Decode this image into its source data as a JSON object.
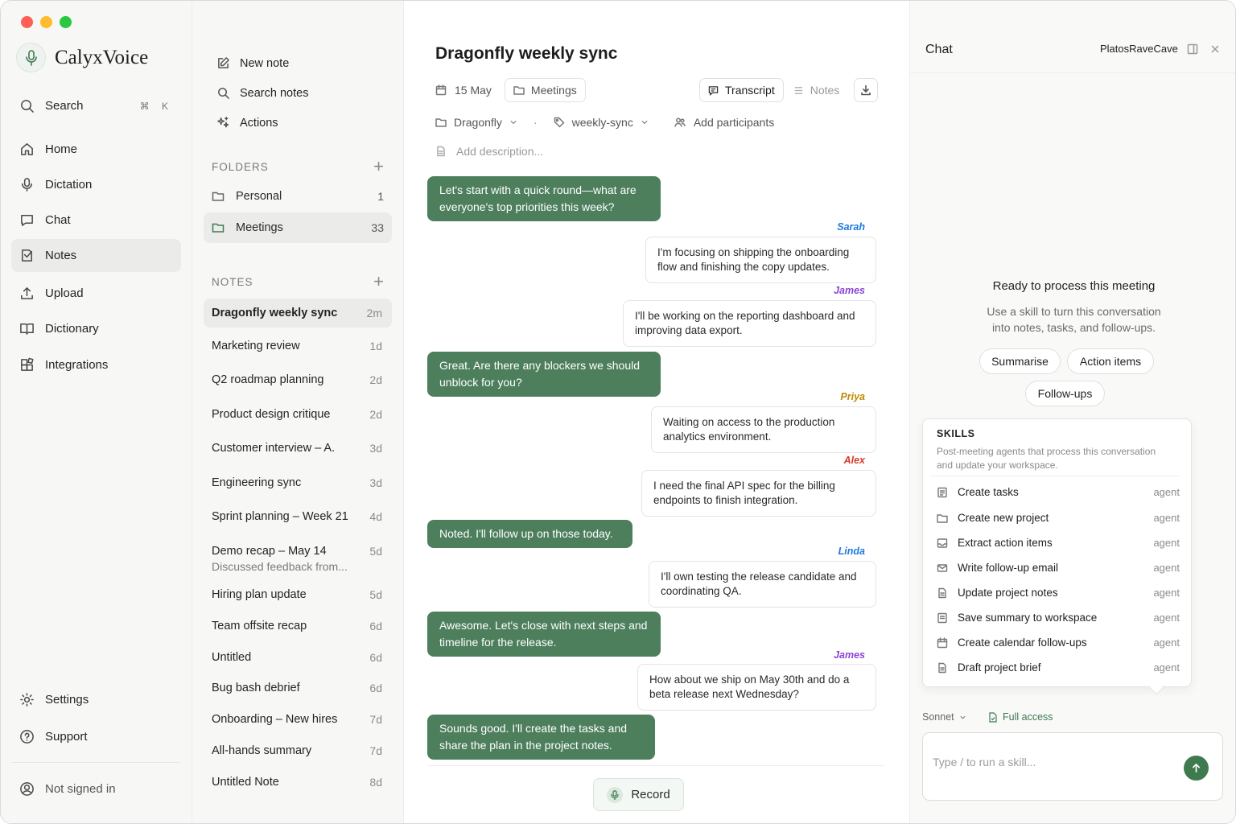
{
  "window": {
    "traffic_colors": [
      "#fe5f57",
      "#febc2e",
      "#28c840"
    ]
  },
  "brand": {
    "name": "CalyxVoice",
    "accent": "#3f7a4f"
  },
  "sidebar": {
    "search": {
      "label": "Search",
      "shortcut": "⌘ K"
    },
    "items": [
      {
        "label": "Home",
        "icon": "home-icon"
      },
      {
        "label": "Dictation",
        "icon": "mic-icon"
      },
      {
        "label": "Chat",
        "icon": "chat-icon"
      },
      {
        "label": "Notes",
        "icon": "notes-icon",
        "active": true
      },
      {
        "label": "Upload",
        "icon": "upload-icon"
      },
      {
        "label": "Dictionary",
        "icon": "book-icon"
      },
      {
        "label": "Integrations",
        "icon": "integrations-icon"
      }
    ],
    "footer": {
      "settings": "Settings",
      "support": "Support",
      "account": "Not signed in"
    }
  },
  "notes_panel": {
    "actions": {
      "new_note": "New note",
      "search_notes": "Search notes",
      "actions": "Actions"
    },
    "folders_heading": "FOLDERS",
    "folders": [
      {
        "name": "Personal",
        "count": "1"
      },
      {
        "name": "Meetings",
        "count": "33",
        "active": true
      }
    ],
    "notes_heading": "NOTES",
    "notes": [
      {
        "title": "Dragonfly weekly sync",
        "age": "2m",
        "active": true
      },
      {
        "title": "Marketing review",
        "age": "1d"
      },
      {
        "title": "Q2 roadmap planning",
        "age": "2d"
      },
      {
        "title": "Product design critique",
        "age": "2d"
      },
      {
        "title": "Customer interview – A.",
        "age": "3d"
      },
      {
        "title": "Engineering sync",
        "age": "3d"
      },
      {
        "title": "Sprint planning – Week 21",
        "age": "4d"
      },
      {
        "title": "Demo recap – May 14",
        "age": "5d",
        "subtitle": "Discussed feedback from..."
      },
      {
        "title": "Hiring plan update",
        "age": "5d"
      },
      {
        "title": "Team offsite recap",
        "age": "6d"
      },
      {
        "title": "Untitled",
        "age": "6d"
      },
      {
        "title": "Bug bash debrief",
        "age": "6d"
      },
      {
        "title": "Onboarding – New hires",
        "age": "7d"
      },
      {
        "title": "All-hands summary",
        "age": "7d"
      },
      {
        "title": "Untitled Note",
        "age": "8d"
      }
    ]
  },
  "meeting": {
    "title": "Dragonfly weekly sync",
    "date": "15 May",
    "folder": "Meetings",
    "view_tabs": {
      "transcript": "Transcript",
      "notes": "Notes",
      "active": "Transcript"
    },
    "project": "Dragonfly",
    "tag": "weekly-sync",
    "participants_label": "Add participants",
    "description_placeholder": "Add description...",
    "record_label": "Record",
    "transcript": [
      {
        "type": "me",
        "text": "Let's start with a quick round—what are everyone's top priorities this week?"
      },
      {
        "type": "other",
        "speaker": "Sarah",
        "color": "#1f7adf",
        "text": "I'm focusing on shipping the onboarding flow and finishing the copy updates."
      },
      {
        "type": "other",
        "speaker": "James",
        "color": "#8a45d6",
        "text": "I'll be working on the reporting dashboard and improving data export."
      },
      {
        "type": "me",
        "text": "Great. Are there any blockers we should unblock for you?"
      },
      {
        "type": "other",
        "speaker": "Priya",
        "color": "#c28a00",
        "text": "Waiting on access to the production analytics environment."
      },
      {
        "type": "other",
        "speaker": "Alex",
        "color": "#d83a2a",
        "text": "I need the final API spec for the billing endpoints to finish integration."
      },
      {
        "type": "me",
        "text": "Noted. I'll follow up on those today."
      },
      {
        "type": "other",
        "speaker": "Linda",
        "color": "#1f7adf",
        "text": "I'll own testing the release candidate and coordinating QA."
      },
      {
        "type": "me",
        "text": "Awesome. Let's close with next steps and timeline for the release."
      },
      {
        "type": "other",
        "speaker": "James",
        "color": "#8a45d6",
        "text": "How about we ship on May 30th and do a beta release next Wednesday?"
      },
      {
        "type": "me",
        "text": "Sounds good. I'll create the tasks and share the plan in the project notes."
      }
    ]
  },
  "chat": {
    "title": "Chat",
    "user": "PlatosRaveCave",
    "empty_title": "Ready to process this meeting",
    "empty_desc_1": "Use a skill to turn this conversation",
    "empty_desc_2": "into notes, tasks, and follow-ups.",
    "quick_actions": [
      "Summarise",
      "Action items",
      "Follow-ups"
    ],
    "skills_heading": "SKILLS",
    "skills_desc": "Post-meeting agents that process this conversation and update your workspace.",
    "skills": [
      {
        "name": "Create tasks",
        "tag": "agent",
        "icon": "checklist-icon"
      },
      {
        "name": "Create new project",
        "tag": "agent",
        "icon": "folder-icon"
      },
      {
        "name": "Extract action items",
        "tag": "agent",
        "icon": "inbox-icon"
      },
      {
        "name": "Write follow-up email",
        "tag": "agent",
        "icon": "mail-icon"
      },
      {
        "name": "Update project notes",
        "tag": "agent",
        "icon": "document-icon"
      },
      {
        "name": "Save summary to workspace",
        "tag": "agent",
        "icon": "summary-icon"
      },
      {
        "name": "Create calendar follow-ups",
        "tag": "agent",
        "icon": "calendar-icon"
      },
      {
        "name": "Draft project brief",
        "tag": "agent",
        "icon": "document-icon"
      }
    ],
    "model": "Sonnet",
    "access": "Full access",
    "input_placeholder": "Type / to run a skill..."
  }
}
